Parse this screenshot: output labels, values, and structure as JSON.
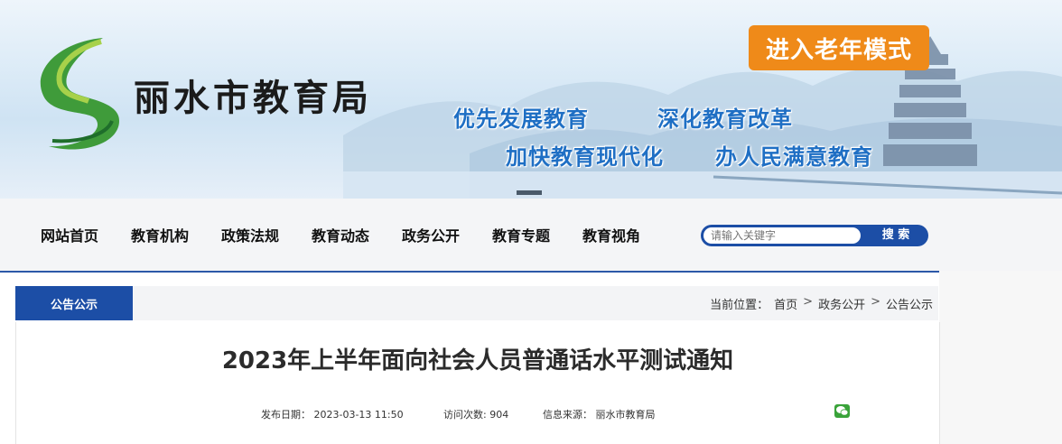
{
  "header": {
    "site_name": "丽水市教育局",
    "elder_mode_label": "进入老年模式",
    "slogans": [
      "优先发展教育",
      "深化教育改革",
      "加快教育现代化",
      "办人民满意教育"
    ]
  },
  "nav": {
    "items": [
      "网站首页",
      "教育机构",
      "政策法规",
      "教育动态",
      "政务公开",
      "教育专题",
      "教育视角"
    ],
    "search_placeholder": "请输入关键字",
    "search_button": "搜 索"
  },
  "section": {
    "tab_label": "公告公示",
    "breadcrumb": {
      "prefix": "当前位置：",
      "items": [
        "首页",
        "政务公开",
        "公告公示"
      ],
      "separator": ">"
    }
  },
  "article": {
    "title": "2023年上半年面向社会人员普通话水平测试通知",
    "publish_label": "发布日期：",
    "publish_date": "2023-03-13  11:50",
    "visits_label": "访问次数:",
    "visits": "904",
    "source_label": "信息来源：",
    "source": "丽水市教育局"
  },
  "icons": {
    "logo": "green-s-brush-logo",
    "share": "wechat-icon"
  },
  "colors": {
    "primary_blue": "#1c4ea6",
    "elder_button": "#ef8a19",
    "slogan_blue": "#1f6fc4"
  }
}
